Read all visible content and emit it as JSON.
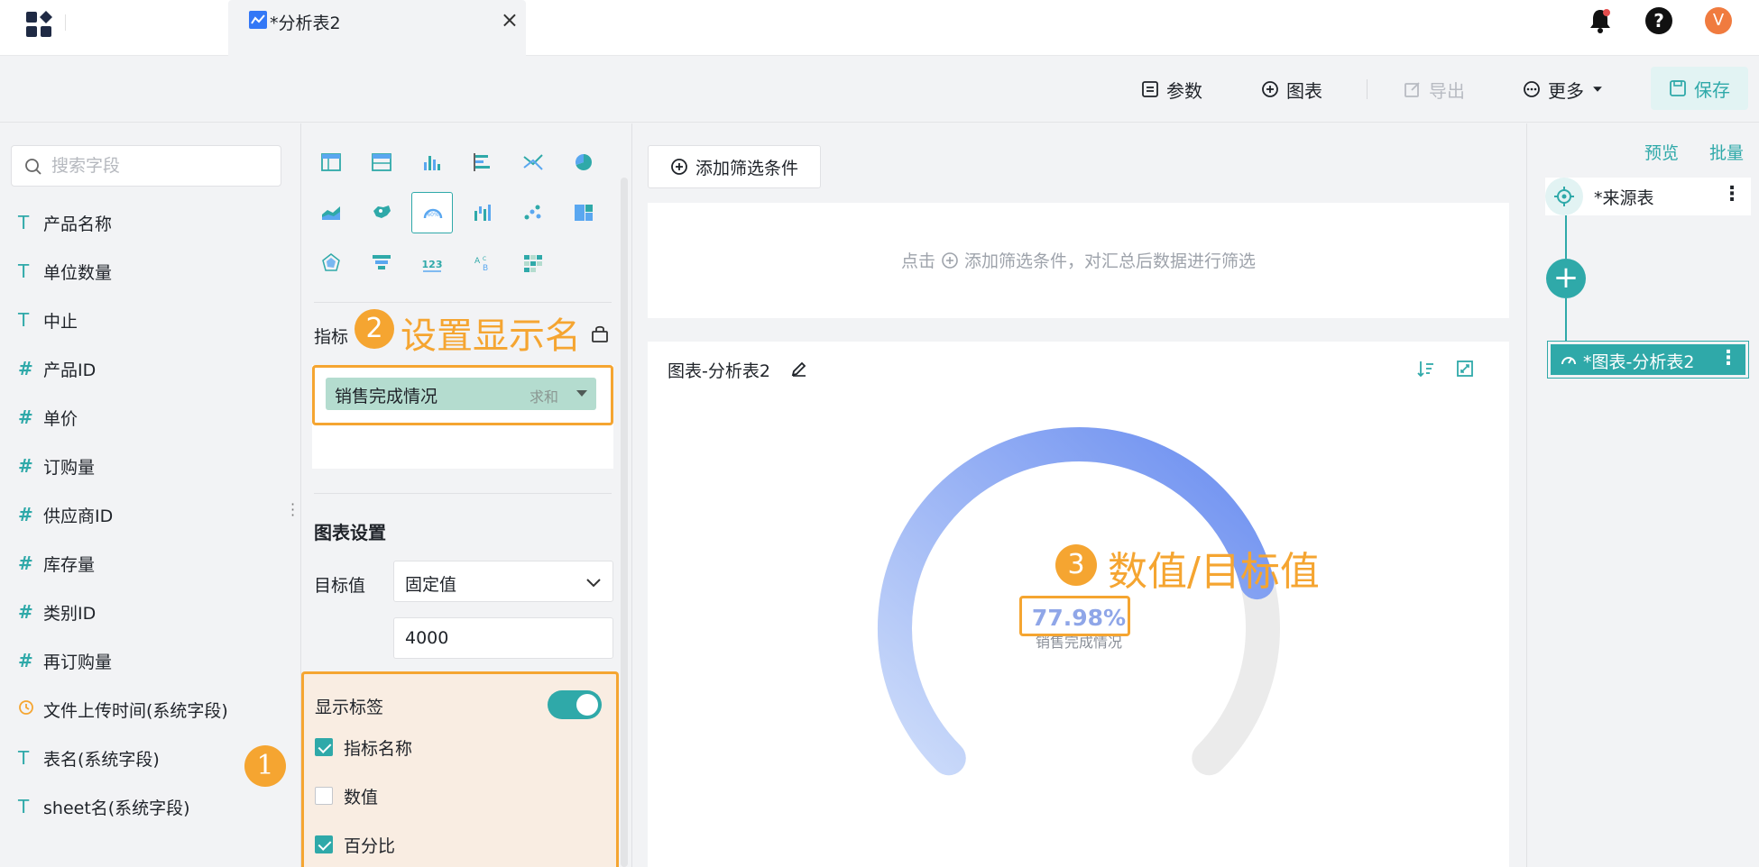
{
  "tab": {
    "title": "*分析表2",
    "close": "×"
  },
  "user": {
    "avatar_letter": "V",
    "help": "?"
  },
  "toolbar": {
    "params": "参数",
    "chart": "图表",
    "export": "导出",
    "more": "更多",
    "save": "保存"
  },
  "fields": {
    "search_placeholder": "搜索字段",
    "items": [
      {
        "type": "T",
        "label": "产品名称"
      },
      {
        "type": "T",
        "label": "单位数量"
      },
      {
        "type": "T",
        "label": "中止"
      },
      {
        "type": "#",
        "label": "产品ID"
      },
      {
        "type": "#",
        "label": "单价"
      },
      {
        "type": "#",
        "label": "订购量"
      },
      {
        "type": "#",
        "label": "供应商ID"
      },
      {
        "type": "#",
        "label": "库存量"
      },
      {
        "type": "#",
        "label": "类别ID"
      },
      {
        "type": "#",
        "label": "再订购量"
      },
      {
        "type": "clock",
        "label": "文件上传时间(系统字段)"
      },
      {
        "type": "T",
        "label": "表名(系统字段)"
      },
      {
        "type": "T",
        "label": "sheet名(系统字段)"
      }
    ]
  },
  "annotations": {
    "badge1": "1",
    "badge2": "2",
    "text2": "设置显示名",
    "badge3": "3",
    "text3": "数值/目标值"
  },
  "config": {
    "metric_label": "指标",
    "metric_name": "销售完成情况",
    "metric_agg": "求和",
    "section_title": "图表设置",
    "target_label": "目标值",
    "target_mode": "固定值",
    "target_value": "4000",
    "show_label": "显示标签",
    "show_label_on": true,
    "checkboxes": [
      {
        "label": "指标名称",
        "checked": true
      },
      {
        "label": "数值",
        "checked": false
      },
      {
        "label": "百分比",
        "checked": true
      }
    ]
  },
  "main": {
    "add_filter": "添加筛选条件",
    "filter_hint_pre": "点击",
    "filter_hint_post": "添加筛选条件，对汇总后数据进行筛选",
    "chart_title": "图表-分析表2",
    "gauge_value": "77.98%",
    "gauge_fraction": 0.7798,
    "gauge_label": "销售完成情况"
  },
  "right": {
    "preview": "预览",
    "batch": "批量",
    "source_node": "*来源表",
    "chart_node": "*图表-分析表2"
  },
  "colors": {
    "accent": "#2fa9a9",
    "annotation": "#f5a531",
    "gauge_start": "#cddcfa",
    "gauge_end": "#6b8ef0",
    "gauge_track": "#ebebeb"
  }
}
